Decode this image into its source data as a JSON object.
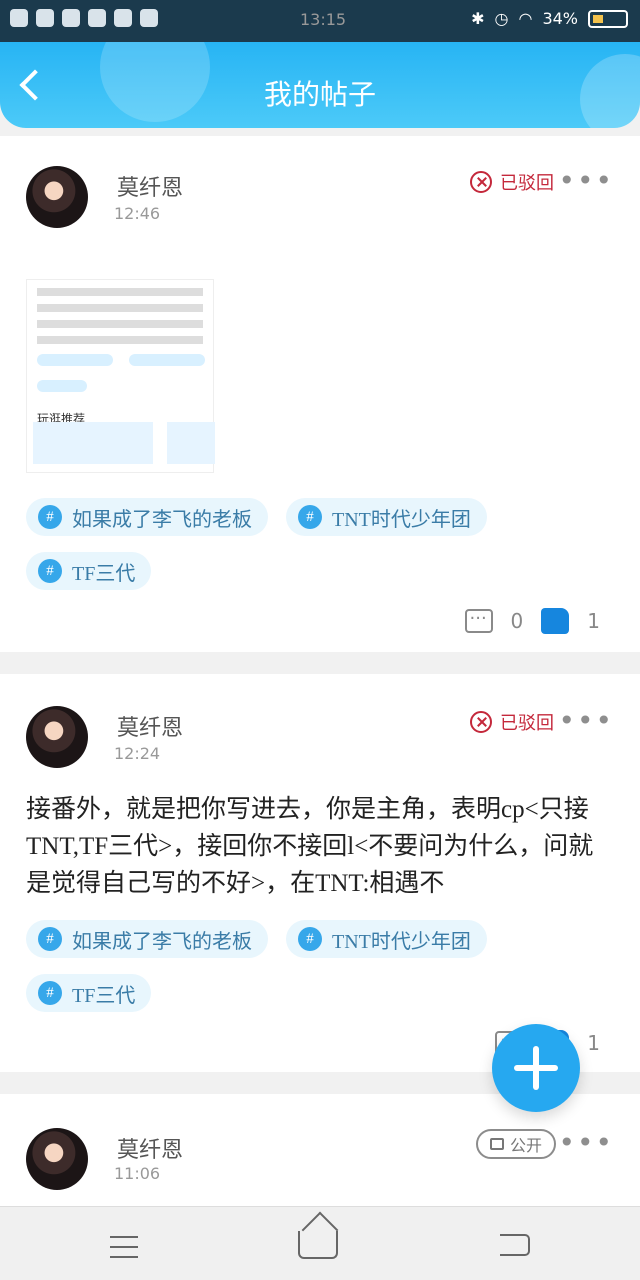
{
  "status_bar": {
    "time": "13:15",
    "battery": "34%"
  },
  "header": {
    "title": "我的帖子"
  },
  "posts": [
    {
      "name": "莫纤恩",
      "time": "12:46",
      "status": "已驳回",
      "tags": [
        "如果成了李飞的老板",
        "TNT时代少年团",
        "TF三代"
      ],
      "comment_count": "0",
      "like_count": "1",
      "thumbnail_section": "玩逛推荐"
    },
    {
      "name": "莫纤恩",
      "time": "12:24",
      "status": "已驳回",
      "text": "接番外，就是把你写进去，你是主角，表明cp<只接TNT,TF三代>，接回你不接回l<不要问为什么，问就是觉得自己写的不好>，在TNT:相遇不",
      "tags": [
        "如果成了李飞的老板",
        "TNT时代少年团",
        "TF三代"
      ],
      "like_count": "1"
    },
    {
      "name": "莫纤恩",
      "time": "11:06",
      "visibility": "公开"
    }
  ]
}
